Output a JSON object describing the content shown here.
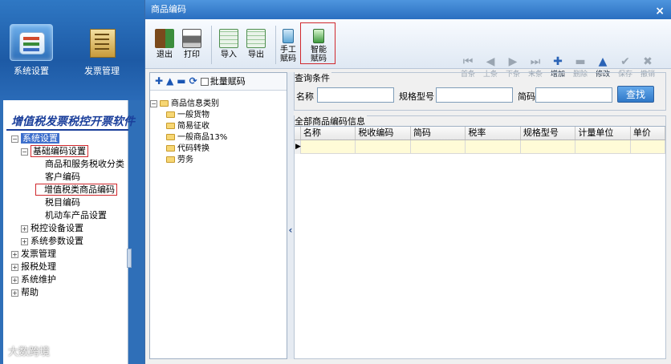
{
  "sidebar": {
    "launcher": [
      {
        "label": "系统设置"
      },
      {
        "label": "发票管理"
      }
    ],
    "brand_title": "增值税发票税控开票软件",
    "tree": [
      {
        "label": "系统设置"
      },
      {
        "label": "基础编码设置"
      },
      {
        "label": "商品和服务税收分类"
      },
      {
        "label": "客户编码"
      },
      {
        "label": "增值税类商品编码"
      },
      {
        "label": "税目编码"
      },
      {
        "label": "机动车产品设置"
      },
      {
        "label": "税控设备设置"
      },
      {
        "label": "系统参数设置"
      },
      {
        "label": "发票管理"
      },
      {
        "label": "报税处理"
      },
      {
        "label": "系统维护"
      },
      {
        "label": "帮助"
      }
    ],
    "watermark": "大数跨境"
  },
  "window": {
    "title": "商品编码",
    "close_glyph": "×"
  },
  "toolbar": {
    "exit_label": "退出",
    "print_label": "打印",
    "import_label": "导入",
    "export_label": "导出",
    "manual_code_label_1": "手工",
    "manual_code_label_2": "赋码",
    "smart_code_label_1": "智能",
    "smart_code_label_2": "赋码",
    "first_label": "首条",
    "prev_label": "上条",
    "next_label": "下条",
    "last_label": "末条",
    "add_label": "增加",
    "delete_label": "删除",
    "edit_label": "修改",
    "save_label": "保存",
    "undo_label": "撤销"
  },
  "category_tree": {
    "batch_label": "批量赋码",
    "root": "商品信息类别",
    "children": [
      "一般货物",
      "简易征收",
      "一般商品13%",
      "代码转换",
      "劳务"
    ]
  },
  "query": {
    "group_title": "查询条件",
    "name_label": "名称",
    "spec_label": "规格型号",
    "short_code_label": "简码",
    "search_label": "查找"
  },
  "results": {
    "group_title": "全部商品编码信息",
    "columns": [
      "名称",
      "税收编码",
      "简码",
      "税率",
      "规格型号",
      "计量单位",
      "单价"
    ]
  },
  "colors": {
    "highlight_red": "#d0282d",
    "selection_blue": "#3d6fcc",
    "titlebar_blue": "#2a6fc0",
    "row_yellow": "#fffbd7"
  }
}
